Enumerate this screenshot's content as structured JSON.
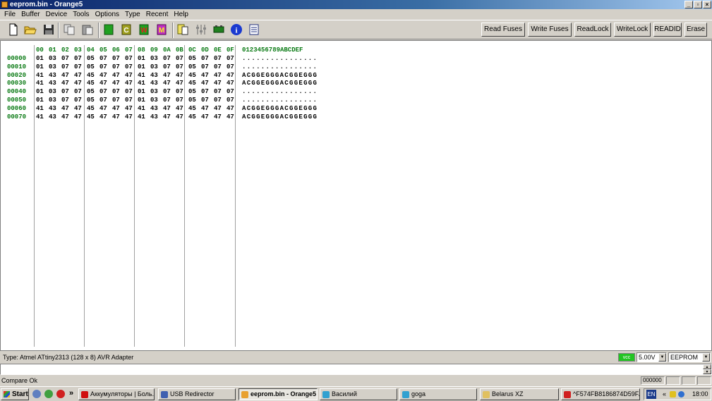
{
  "window": {
    "title": "eeprom.bin - Orange5",
    "controls": [
      "_",
      "▫",
      "×"
    ]
  },
  "menu": [
    "File",
    "Buffer",
    "Device",
    "Tools",
    "Options",
    "Type",
    "Recent",
    "Help"
  ],
  "toolbar": {
    "icons": [
      "new-file-icon",
      "open-folder-icon",
      "save-icon",
      "copy-icon",
      "paste-icon",
      "chip-green-icon",
      "chip-c-icon",
      "chip-w-icon",
      "chip-m-icon",
      "clipboard-icon",
      "sliders-icon",
      "adapter-icon",
      "info-icon",
      "report-icon"
    ],
    "buttons": [
      "Read Fuses",
      "Write Fuses",
      "ReadLock",
      "WriteLock",
      "READID",
      "Erase"
    ]
  },
  "hex": {
    "columns": [
      "00",
      "01",
      "02",
      "03",
      "04",
      "05",
      "06",
      "07",
      "08",
      "09",
      "0A",
      "0B",
      "0C",
      "0D",
      "0E",
      "0F"
    ],
    "ascii_header": "0123456789ABCDEF",
    "rows": [
      {
        "addr": "00000",
        "bytes": [
          "01",
          "03",
          "07",
          "07",
          "05",
          "07",
          "07",
          "07",
          "01",
          "03",
          "07",
          "07",
          "05",
          "07",
          "07",
          "07"
        ],
        "ascii": "................"
      },
      {
        "addr": "00010",
        "bytes": [
          "01",
          "03",
          "07",
          "07",
          "05",
          "07",
          "07",
          "07",
          "01",
          "03",
          "07",
          "07",
          "05",
          "07",
          "07",
          "07"
        ],
        "ascii": "................"
      },
      {
        "addr": "00020",
        "bytes": [
          "41",
          "43",
          "47",
          "47",
          "45",
          "47",
          "47",
          "47",
          "41",
          "43",
          "47",
          "47",
          "45",
          "47",
          "47",
          "47"
        ],
        "ascii": "ACGGEGGGACGGEGGG"
      },
      {
        "addr": "00030",
        "bytes": [
          "41",
          "43",
          "47",
          "47",
          "45",
          "47",
          "47",
          "47",
          "41",
          "43",
          "47",
          "47",
          "45",
          "47",
          "47",
          "47"
        ],
        "ascii": "ACGGEGGGACGGEGGG"
      },
      {
        "addr": "00040",
        "bytes": [
          "01",
          "03",
          "07",
          "07",
          "05",
          "07",
          "07",
          "07",
          "01",
          "03",
          "07",
          "07",
          "05",
          "07",
          "07",
          "07"
        ],
        "ascii": "................"
      },
      {
        "addr": "00050",
        "bytes": [
          "01",
          "03",
          "07",
          "07",
          "05",
          "07",
          "07",
          "07",
          "01",
          "03",
          "07",
          "07",
          "05",
          "07",
          "07",
          "07"
        ],
        "ascii": "................"
      },
      {
        "addr": "00060",
        "bytes": [
          "41",
          "43",
          "47",
          "47",
          "45",
          "47",
          "47",
          "47",
          "41",
          "43",
          "47",
          "47",
          "45",
          "47",
          "47",
          "47"
        ],
        "ascii": "ACGGEGGGACGGEGGG"
      },
      {
        "addr": "00070",
        "bytes": [
          "41",
          "43",
          "47",
          "47",
          "45",
          "47",
          "47",
          "47",
          "41",
          "43",
          "47",
          "47",
          "45",
          "47",
          "47",
          "47"
        ],
        "ascii": "ACGGEGGGACGGEGGG"
      }
    ]
  },
  "status": {
    "device_type": "Type: Atmel ATtiny2313 (128 x 8)   AVR Adapter",
    "vcc_label": "vcc",
    "voltage": "5.00V",
    "memory": "EEPROM",
    "message": "Compare Ok",
    "address": "000000"
  },
  "taskbar": {
    "start": "Start",
    "more": "»",
    "tasks": [
      {
        "label": "Аккумуляторы | Боль...",
        "icon_color": "#d01010"
      },
      {
        "label": "USB Redirector",
        "icon_color": "#4060b0"
      },
      {
        "label": "eeprom.bin - Orange5",
        "icon_color": "#e8a030"
      },
      {
        "label": "Василий",
        "icon_color": "#30a0d0"
      },
      {
        "label": "goga",
        "icon_color": "#30a0d0"
      },
      {
        "label": "Belarus XZ",
        "icon_color": "#e0c060"
      },
      {
        "label": "^F574FB8186874D59F...",
        "icon_color": "#d02020"
      }
    ],
    "lang": "EN",
    "tray_arrow": "«",
    "clock": "18:00"
  },
  "colors": {
    "hex_header": "#0a7a14",
    "vcc_indicator": "#22c422",
    "title_bar": "#0a246a"
  }
}
